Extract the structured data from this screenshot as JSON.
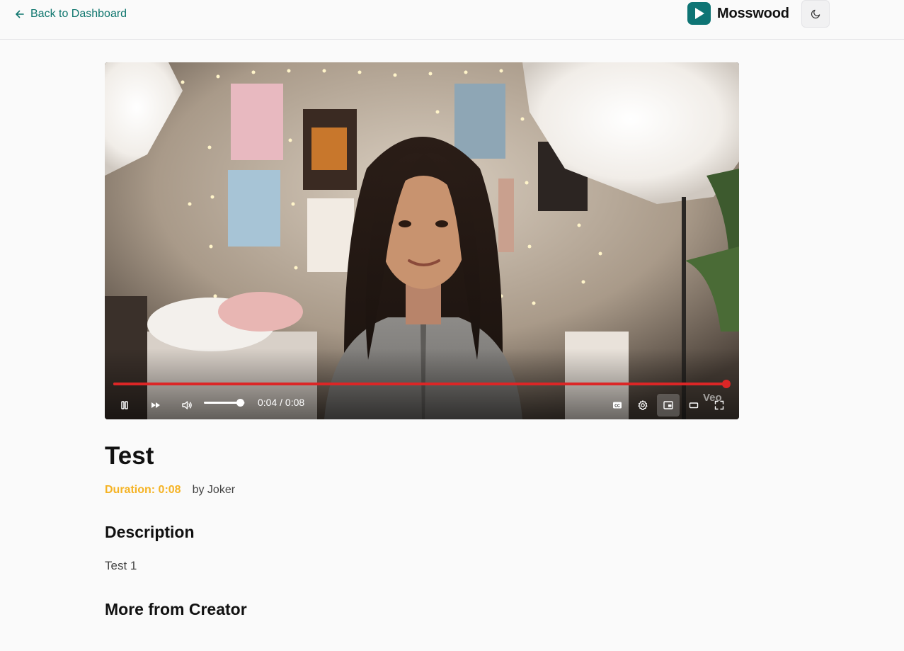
{
  "header": {
    "back_label": "Back to Dashboard",
    "brand_name": "Mosswood",
    "theme_toggle_icon": "moon-icon"
  },
  "player": {
    "progress_fraction": 1.0,
    "volume_fraction": 0.9,
    "time_display": "0:04 / 0:08",
    "watermark": "Veo",
    "controls": [
      "pause-icon",
      "fast-forward-icon",
      "volume-icon",
      "captions-icon",
      "settings-icon",
      "picture-in-picture-icon",
      "theater-mode-icon",
      "fullscreen-icon"
    ],
    "accent_color": "#dc2626"
  },
  "video": {
    "title": "Test",
    "duration": "Duration: 0:08",
    "author": "by Joker",
    "description_heading": "Description",
    "description": "Test 1",
    "more_heading": "More from Creator"
  },
  "colors": {
    "link": "#0f766e",
    "brand": "#0e7474",
    "duration": "#f5b324"
  }
}
